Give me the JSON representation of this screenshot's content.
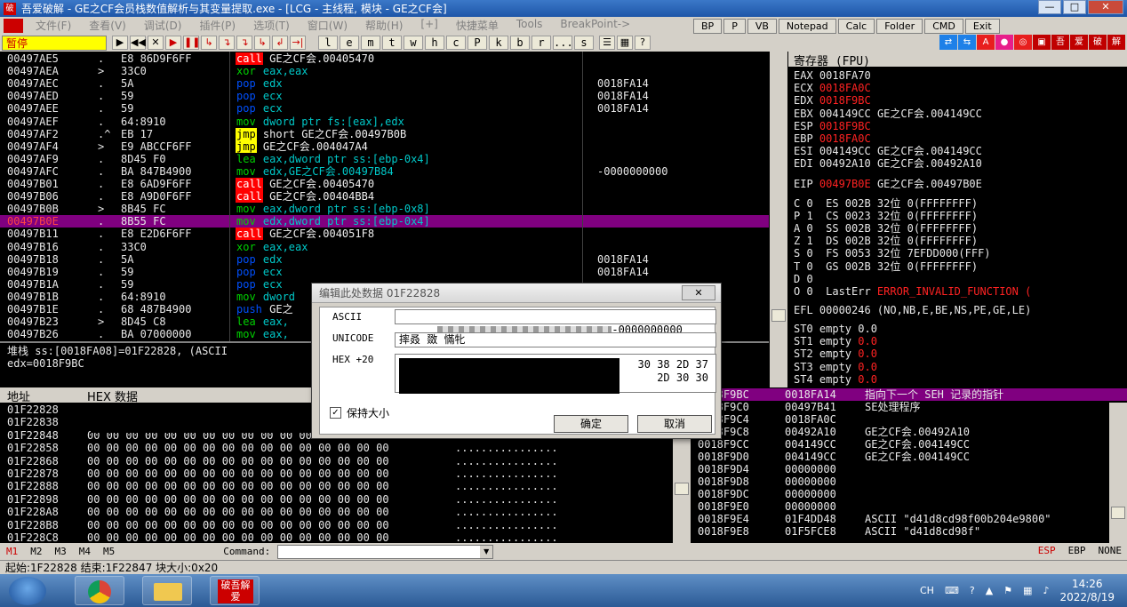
{
  "window": {
    "title": "吾爱破解 - GE之CF会员栈数值解析与其变量提取.exe - [LCG - 主线程, 模块 - GE之CF会]",
    "app_icon": "破"
  },
  "window_controls": {
    "minimize": "—",
    "maximize": "□",
    "close": "✕"
  },
  "menu": [
    {
      "label": "文件(F)"
    },
    {
      "label": "查看(V)"
    },
    {
      "label": "调试(D)"
    },
    {
      "label": "插件(P)"
    },
    {
      "label": "选项(T)"
    },
    {
      "label": "窗口(W)"
    },
    {
      "label": "帮助(H)"
    },
    {
      "label": "[+]"
    },
    {
      "label": "快捷菜单"
    },
    {
      "label": "Tools"
    },
    {
      "label": "BreakPoint->"
    }
  ],
  "menu_buttons": [
    "BP",
    "P",
    "VB",
    "Notepad",
    "Calc",
    "Folder",
    "CMD",
    "Exit"
  ],
  "toolbar": {
    "status": "暂停",
    "buttons": [
      "▶",
      "◀◀",
      "✕",
      "▶",
      "❚❚",
      "↳",
      "↴",
      "↴",
      "↳",
      "↲",
      "→|"
    ],
    "letters": [
      "l",
      "e",
      "m",
      "t",
      "w",
      "h",
      "c",
      "P",
      "k",
      "b",
      "r",
      "...",
      "s"
    ],
    "extra": [
      "☰",
      "▦",
      "?"
    ]
  },
  "right_icons": [
    {
      "label": "⇄",
      "color": "#1e80e8"
    },
    {
      "label": "⇆",
      "color": "#1e80e8"
    },
    {
      "label": "A",
      "color": "#e81e1e"
    },
    {
      "label": "●",
      "color": "#e81e8a"
    },
    {
      "label": "◎",
      "color": "#e81e1e"
    },
    {
      "label": "▣",
      "color": "#c00000"
    },
    {
      "label": "吾",
      "color": "#c00000"
    },
    {
      "label": "爱",
      "color": "#c00000"
    },
    {
      "label": "破",
      "color": "#c00000"
    },
    {
      "label": "解",
      "color": "#c00000"
    }
  ],
  "disasm": [
    {
      "addr": "00497AE5",
      "mark": ".",
      "hex": "E8 86D9F6FF",
      "op": "call",
      "opk": "call",
      "args": " GE之CF会.00405470",
      "argk": "white",
      "cmt": ""
    },
    {
      "addr": "00497AEA",
      "mark": ">",
      "hex": "33C0",
      "op": "xor",
      "opk": "green",
      "args": " eax,eax",
      "argk": "cyan",
      "cmt": ""
    },
    {
      "addr": "00497AEC",
      "mark": ".",
      "hex": "5A",
      "op": "pop",
      "opk": "pop",
      "args": " edx",
      "argk": "cyan",
      "cmt": "0018FA14"
    },
    {
      "addr": "00497AED",
      "mark": ".",
      "hex": "59",
      "op": "pop",
      "opk": "pop",
      "args": " ecx",
      "argk": "cyan",
      "cmt": "0018FA14"
    },
    {
      "addr": "00497AEE",
      "mark": ".",
      "hex": "59",
      "op": "pop",
      "opk": "pop",
      "args": " ecx",
      "argk": "cyan",
      "cmt": "0018FA14"
    },
    {
      "addr": "00497AEF",
      "mark": ".",
      "hex": "64:8910",
      "op": "mov",
      "opk": "green",
      "args": " dword ptr fs:[eax],edx",
      "argk": "cyan",
      "cmt": ""
    },
    {
      "addr": "00497AF2",
      "mark": ".^",
      "hex": "EB 17",
      "op": "jmp",
      "opk": "jmp",
      "args": " short GE之CF会.00497B0B",
      "argk": "white",
      "cmt": ""
    },
    {
      "addr": "00497AF4",
      "mark": ">",
      "hex": "E9 ABCCF6FF",
      "op": "jmp",
      "opk": "jmp",
      "args": " GE之CF会.004047A4",
      "argk": "white",
      "cmt": ""
    },
    {
      "addr": "00497AF9",
      "mark": ".",
      "hex": "8D45 F0",
      "op": "lea",
      "opk": "green",
      "args": " eax,dword ptr ss:[ebp-0x4]",
      "argk": "cyan",
      "cmt": ""
    },
    {
      "addr": "00497AFC",
      "mark": ".",
      "hex": "BA 847B4900",
      "op": "mov",
      "opk": "green",
      "args": " edx,GE之CF会.00497B84",
      "argk": "cyan",
      "cmt": "-0000000000"
    },
    {
      "addr": "00497B01",
      "mark": ".",
      "hex": "E8 6AD9F6FF",
      "op": "call",
      "opk": "call",
      "args": " GE之CF会.00405470",
      "argk": "white",
      "cmt": ""
    },
    {
      "addr": "00497B06",
      "mark": ".",
      "hex": "E8 A9D0F6FF",
      "op": "call",
      "opk": "call",
      "args": " GE之CF会.00404BB4",
      "argk": "white",
      "cmt": ""
    },
    {
      "addr": "00497B0B",
      "mark": ">",
      "hex": "8B45 FC",
      "op": "mov",
      "opk": "green",
      "args": " eax,dword ptr ss:[ebp-0x8]",
      "argk": "cyan",
      "cmt": ""
    },
    {
      "addr": "00497B0E",
      "mark": ".",
      "hex": "8B55 FC",
      "op": "mov",
      "opk": "green",
      "args": " edx,dword ptr ss:[ebp-0x4]",
      "argk": "cyan",
      "cmt": "",
      "sel": true
    },
    {
      "addr": "00497B11",
      "mark": ".",
      "hex": "E8 E2D6F6FF",
      "op": "call",
      "opk": "call",
      "args": " GE之CF会.004051F8",
      "argk": "white",
      "cmt": ""
    },
    {
      "addr": "00497B16",
      "mark": ".",
      "hex": "33C0",
      "op": "xor",
      "opk": "green",
      "args": " eax,eax",
      "argk": "cyan",
      "cmt": ""
    },
    {
      "addr": "00497B18",
      "mark": ".",
      "hex": "5A",
      "op": "pop",
      "opk": "pop",
      "args": " edx",
      "argk": "cyan",
      "cmt": "0018FA14"
    },
    {
      "addr": "00497B19",
      "mark": ".",
      "hex": "59",
      "op": "pop",
      "opk": "pop",
      "args": " ecx",
      "argk": "cyan",
      "cmt": "0018FA14"
    },
    {
      "addr": "00497B1A",
      "mark": ".",
      "hex": "59",
      "op": "pop",
      "opk": "pop",
      "args": " ecx",
      "argk": "cyan",
      "cmt": ""
    },
    {
      "addr": "00497B1B",
      "mark": ".",
      "hex": "64:8910",
      "op": "mov",
      "opk": "green",
      "args": " dword",
      "argk": "cyan",
      "cmt": ""
    },
    {
      "addr": "00497B1E",
      "mark": ".",
      "hex": "68 487B4900",
      "op": "push",
      "opk": "pop",
      "args": " GE之",
      "argk": "white",
      "cmt": ""
    },
    {
      "addr": "00497B23",
      "mark": ">",
      "hex": "8D45 C8",
      "op": "lea",
      "opk": "green",
      "args": " eax,",
      "argk": "cyan",
      "cmt": ""
    },
    {
      "addr": "00497B26",
      "mark": ".",
      "hex": "BA 07000000",
      "op": "mov",
      "opk": "green",
      "args": " eax,",
      "argk": "cyan",
      "cmt": ""
    }
  ],
  "info": {
    "line1": "堆栈 ss:[0018FA08]=01F22828, (ASCII",
    "line2": "edx=0018F9BC"
  },
  "registers": {
    "header": "寄存器 (FPU)",
    "rows": [
      {
        "name": "EAX",
        "value": "0018FA70",
        "red": false,
        "cmt": ""
      },
      {
        "name": "ECX",
        "value": "0018FA0C",
        "red": true,
        "cmt": ""
      },
      {
        "name": "EDX",
        "value": "0018F9BC",
        "red": true,
        "cmt": ""
      },
      {
        "name": "EBX",
        "value": "004149CC",
        "red": false,
        "cmt": "GE之CF会.004149CC"
      },
      {
        "name": "ESP",
        "value": "0018F9BC",
        "red": true,
        "cmt": ""
      },
      {
        "name": "EBP",
        "value": "0018FA0C",
        "red": true,
        "cmt": ""
      },
      {
        "name": "ESI",
        "value": "004149CC",
        "red": false,
        "cmt": "GE之CF会.004149CC"
      },
      {
        "name": "EDI",
        "value": "00492A10",
        "red": false,
        "cmt": "GE之CF会.00492A10"
      }
    ],
    "eip": {
      "name": "EIP",
      "value": "00497B0E",
      "cmt": "GE之CF会.00497B0E"
    },
    "flags": [
      {
        "text": "C 0  ES 002B 32位 0(FFFFFFFF)"
      },
      {
        "text": "P 1  CS 0023 32位 0(FFFFFFFF)"
      },
      {
        "text": "A 0  SS 002B 32位 0(FFFFFFFF)"
      },
      {
        "text": "Z 1  DS 002B 32位 0(FFFFFFFF)"
      },
      {
        "text": "S 0  FS 0053 32位 7EFDD000(FFF)"
      },
      {
        "text": "T 0  GS 002B 32位 0(FFFFFFFF)"
      },
      {
        "text": "D 0"
      }
    ],
    "lasterr_prefix": "O 0  LastErr ",
    "lasterr": "ERROR_INVALID_FUNCTION (",
    "efl": "EFL 00000246 (NO,NB,E,BE,NS,PE,GE,LE)",
    "fpu": [
      {
        "name": "ST0",
        "text": " empty ",
        "val": "0.0",
        "red": false
      },
      {
        "name": "ST1",
        "text": " empty ",
        "val": "0.0",
        "red": true
      },
      {
        "name": "ST2",
        "text": " empty ",
        "val": "0.0",
        "red": true
      },
      {
        "name": "ST3",
        "text": " empty ",
        "val": "0.0",
        "red": true
      },
      {
        "name": "ST4",
        "text": " empty ",
        "val": "0.0",
        "red": true
      }
    ]
  },
  "dump": {
    "col_addr": "地址",
    "col_hex": "HEX 数据",
    "rows": [
      {
        "addr": "01F22828",
        "bytes": "                                                        ",
        "ascii": ""
      },
      {
        "addr": "01F22838",
        "bytes": "                                                        ",
        "ascii": ""
      },
      {
        "addr": "01F22848",
        "bytes": "00 00 00 00 00 00 00 00 00 00 00 00 00 00 00 00",
        "ascii": "................"
      },
      {
        "addr": "01F22858",
        "bytes": "00 00 00 00 00 00 00 00 00 00 00 00 00 00 00 00",
        "ascii": "................"
      },
      {
        "addr": "01F22868",
        "bytes": "00 00 00 00 00 00 00 00 00 00 00 00 00 00 00 00",
        "ascii": "................"
      },
      {
        "addr": "01F22878",
        "bytes": "00 00 00 00 00 00 00 00 00 00 00 00 00 00 00 00",
        "ascii": "................"
      },
      {
        "addr": "01F22888",
        "bytes": "00 00 00 00 00 00 00 00 00 00 00 00 00 00 00 00",
        "ascii": "................"
      },
      {
        "addr": "01F22898",
        "bytes": "00 00 00 00 00 00 00 00 00 00 00 00 00 00 00 00",
        "ascii": "................"
      },
      {
        "addr": "01F228A8",
        "bytes": "00 00 00 00 00 00 00 00 00 00 00 00 00 00 00 00",
        "ascii": "................"
      },
      {
        "addr": "01F228B8",
        "bytes": "00 00 00 00 00 00 00 00 00 00 00 00 00 00 00 00",
        "ascii": "................"
      },
      {
        "addr": "01F228C8",
        "bytes": "00 00 00 00 00 00 00 00 00 00 00 00 00 00 00 00",
        "ascii": "................"
      }
    ]
  },
  "stack": {
    "rows": [
      {
        "a": "0018F9BC",
        "v": "0018FA14",
        "c": "指向下一个 SEH 记录的指针",
        "sel": true
      },
      {
        "a": "0018F9C0",
        "v": "00497B41",
        "c": "SE处理程序"
      },
      {
        "a": "0018F9C4",
        "v": "0018FA0C",
        "c": ""
      },
      {
        "a": "0018F9C8",
        "v": "00492A10",
        "c": "GE之CF会.00492A10"
      },
      {
        "a": "0018F9CC",
        "v": "004149CC",
        "c": "GE之CF会.004149CC"
      },
      {
        "a": "0018F9D0",
        "v": "004149CC",
        "c": "GE之CF会.004149CC"
      },
      {
        "a": "0018F9D4",
        "v": "00000000",
        "c": ""
      },
      {
        "a": "0018F9D8",
        "v": "00000000",
        "c": ""
      },
      {
        "a": "0018F9DC",
        "v": "00000000",
        "c": ""
      },
      {
        "a": "0018F9E0",
        "v": "00000000",
        "c": ""
      },
      {
        "a": "0018F9E4",
        "v": "01F4DD48",
        "c": "ASCII \"d41d8cd98f00b204e9800\""
      },
      {
        "a": "0018F9E8",
        "v": "01F5FCE8",
        "c": "ASCII \"d41d8cd98f\""
      }
    ]
  },
  "command": {
    "marks": [
      "M1",
      "M2",
      "M3",
      "M4",
      "M5"
    ],
    "label": "Command:",
    "value": "",
    "right": [
      "ESP",
      "EBP",
      "NONE"
    ]
  },
  "status": "起始:1F22828 结束:1F22847 块大小:0x20",
  "dialog": {
    "title": "编辑此处数据 01F22828",
    "close": "✕",
    "ascii_label": "ASCII",
    "ascii_value": "-0000000000",
    "unicode_label": "UNICODE",
    "unicode_value": "摔叒 敪 慲牝",
    "hex_label": "HEX +20",
    "hex_line1": "30 38 2D 37",
    "hex_line2": "2D 30 30",
    "keep_size": "保持大小",
    "keep_size_checked": "✓",
    "ok": "确定",
    "cancel": "取消"
  },
  "tray": {
    "lang": "CH",
    "time": "14:26",
    "date": "2022/8/19"
  },
  "taskbar": {
    "tile_label": "破吾解爱"
  }
}
